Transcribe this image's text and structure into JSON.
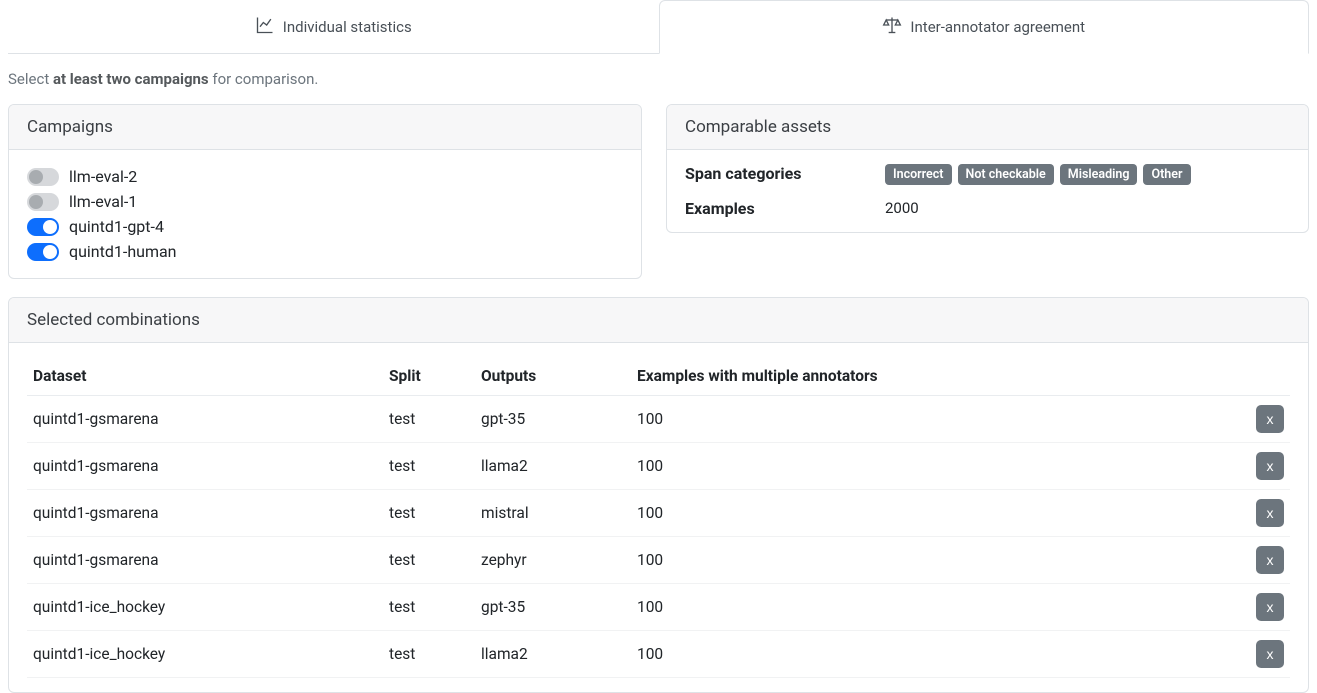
{
  "tabs": {
    "individual": "Individual statistics",
    "iaa": "Inter-annotator agreement"
  },
  "instruction": {
    "prefix": "Select ",
    "bold": "at least two campaigns",
    "suffix": " for comparison."
  },
  "campaigns": {
    "header": "Campaigns",
    "items": [
      {
        "label": "llm-eval-2",
        "on": false
      },
      {
        "label": "llm-eval-1",
        "on": false
      },
      {
        "label": "quintd1-gpt-4",
        "on": true
      },
      {
        "label": "quintd1-human",
        "on": true
      }
    ]
  },
  "assets": {
    "header": "Comparable assets",
    "span_label": "Span categories",
    "span_categories": [
      "Incorrect",
      "Not checkable",
      "Misleading",
      "Other"
    ],
    "examples_label": "Examples",
    "examples_value": "2000"
  },
  "combos": {
    "header": "Selected combinations",
    "columns": {
      "dataset": "Dataset",
      "split": "Split",
      "outputs": "Outputs",
      "examples": "Examples with multiple annotators"
    },
    "delete_label": "x",
    "rows": [
      {
        "dataset": "quintd1-gsmarena",
        "split": "test",
        "outputs": "gpt-35",
        "examples": "100"
      },
      {
        "dataset": "quintd1-gsmarena",
        "split": "test",
        "outputs": "llama2",
        "examples": "100"
      },
      {
        "dataset": "quintd1-gsmarena",
        "split": "test",
        "outputs": "mistral",
        "examples": "100"
      },
      {
        "dataset": "quintd1-gsmarena",
        "split": "test",
        "outputs": "zephyr",
        "examples": "100"
      },
      {
        "dataset": "quintd1-ice_hockey",
        "split": "test",
        "outputs": "gpt-35",
        "examples": "100"
      },
      {
        "dataset": "quintd1-ice_hockey",
        "split": "test",
        "outputs": "llama2",
        "examples": "100"
      }
    ]
  }
}
